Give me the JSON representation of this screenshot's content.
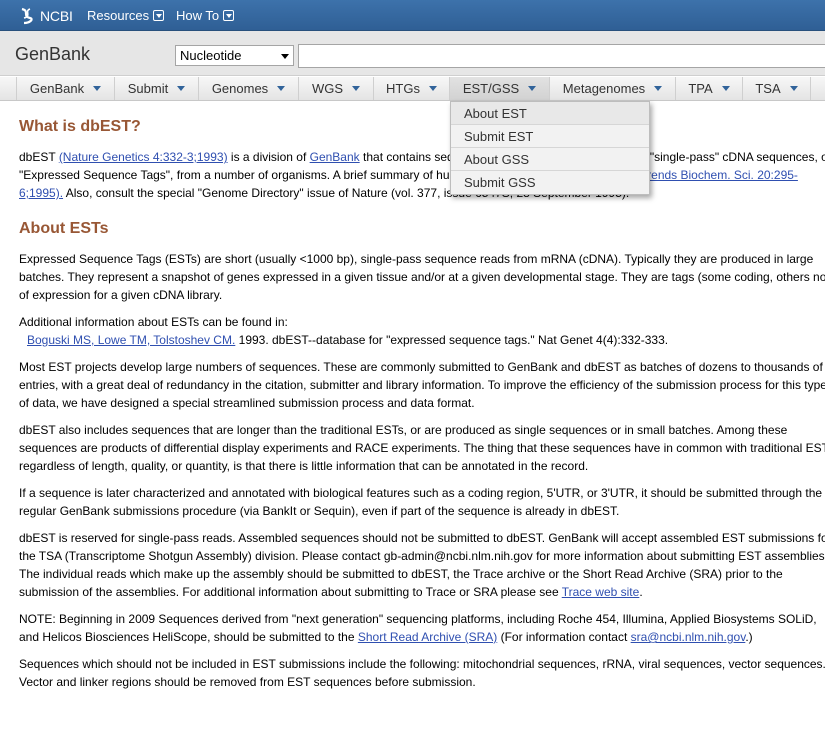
{
  "topbar": {
    "logo_text": "NCBI",
    "menus": [
      {
        "label": "Resources"
      },
      {
        "label": "How To"
      }
    ]
  },
  "searchbar": {
    "title": "GenBank",
    "database": "Nucleotide",
    "term": ""
  },
  "nav": {
    "tabs": [
      {
        "label": "GenBank"
      },
      {
        "label": "Submit"
      },
      {
        "label": "Genomes"
      },
      {
        "label": "WGS"
      },
      {
        "label": "HTGs"
      },
      {
        "label": "EST/GSS"
      },
      {
        "label": "Metagenomes"
      },
      {
        "label": "TPA"
      },
      {
        "label": "TSA"
      }
    ],
    "active_tab": "EST/GSS"
  },
  "dropdown": {
    "items": [
      {
        "label": "About EST"
      },
      {
        "label": "Submit EST"
      },
      {
        "label": "About GSS"
      },
      {
        "label": "Submit GSS"
      }
    ]
  },
  "content": {
    "h1": "What is dbEST?",
    "p1": {
      "t1": "dbEST ",
      "link1": "(Nature Genetics 4:332-3;1993)",
      "t2": " is a division of ",
      "link2": "GenBank",
      "t3": " that contains sequence data and other information on \"single-pass\" cDNA sequences, or \"Expressed Sequence Tags\", from a number of organisms. A brief summary of human ESTs in GenBank is available ",
      "link3": "(Trends Biochem. Sci. 20:295-6;1995).",
      "t4": " Also, consult the special \"Genome Directory\" issue of Nature (vol. 377, issue 6547S, 28 September 1995)."
    },
    "h2": "About ESTs",
    "p2": "Expressed Sequence Tags (ESTs) are short (usually <1000 bp), single-pass sequence reads from mRNA (cDNA). Typically they are produced in large batches. They represent a snapshot of genes expressed in a given tissue and/or at a given developmental stage. They are tags (some coding, others not) of expression for a given cDNA library.",
    "p3": "Additional information about ESTs can be found in:",
    "ref": {
      "authors": "Boguski MS, Lowe TM, Tolstoshev CM.",
      "rest": " 1993.  dbEST--database for \"expressed sequence tags.\" Nat Genet 4(4):332-333."
    },
    "p4": "Most EST projects develop large numbers of sequences. These are commonly submitted to GenBank and dbEST as batches of dozens to thousands of entries, with a great deal of redundancy in the citation, submitter and library information. To improve the efficiency of the submission process for this type of data, we have designed a special streamlined submission process and data format.",
    "p5": "dbEST also includes sequences that are longer than the traditional ESTs, or are produced as single sequences or in small batches. Among these sequences are products of differential display experiments and RACE experiments. The thing that these sequences have in common with traditional ESTs, regardless of length, quality, or quantity, is that there is little information that can be annotated in the record.",
    "p6": "If a sequence is later characterized and annotated with biological features such as a coding region, 5'UTR, or 3'UTR, it should be submitted through the regular GenBank submissions procedure (via BankIt or Sequin), even if part of the sequence is already in dbEST.",
    "p7": {
      "t1": "dbEST is reserved for single-pass reads. Assembled sequences should not be submitted to dbEST. GenBank will accept assembled EST submissions for the TSA (Transcriptome Shotgun Assembly) division. Please contact gb-admin@ncbi.nlm.nih.gov for more information about submitting EST assemblies. The individual reads which make up the assembly should be submitted to dbEST, the Trace archive or the Short Read Archive (SRA) prior to the submission of the assemblies. For additional information about submitting to Trace or SRA please see ",
      "link": "Trace web site",
      "t2": "."
    },
    "p8": {
      "t1": "NOTE: Beginning in 2009 Sequences derived from \"next generation\" sequencing platforms, including Roche 454, Illumina, Applied Biosystems SOLiD, and Helicos Biosciences HeliScope, should be submitted to the ",
      "link1": "Short Read Archive (SRA)",
      "t2": " (For information contact ",
      "link2": "sra@ncbi.nlm.nih.gov",
      "t3": ".)"
    },
    "p9": "Sequences which should not be included in EST submissions include the following: mitochondrial sequences, rRNA, viral sequences, vector sequences. Vector and linker regions should be removed from EST sequences before submission."
  }
}
